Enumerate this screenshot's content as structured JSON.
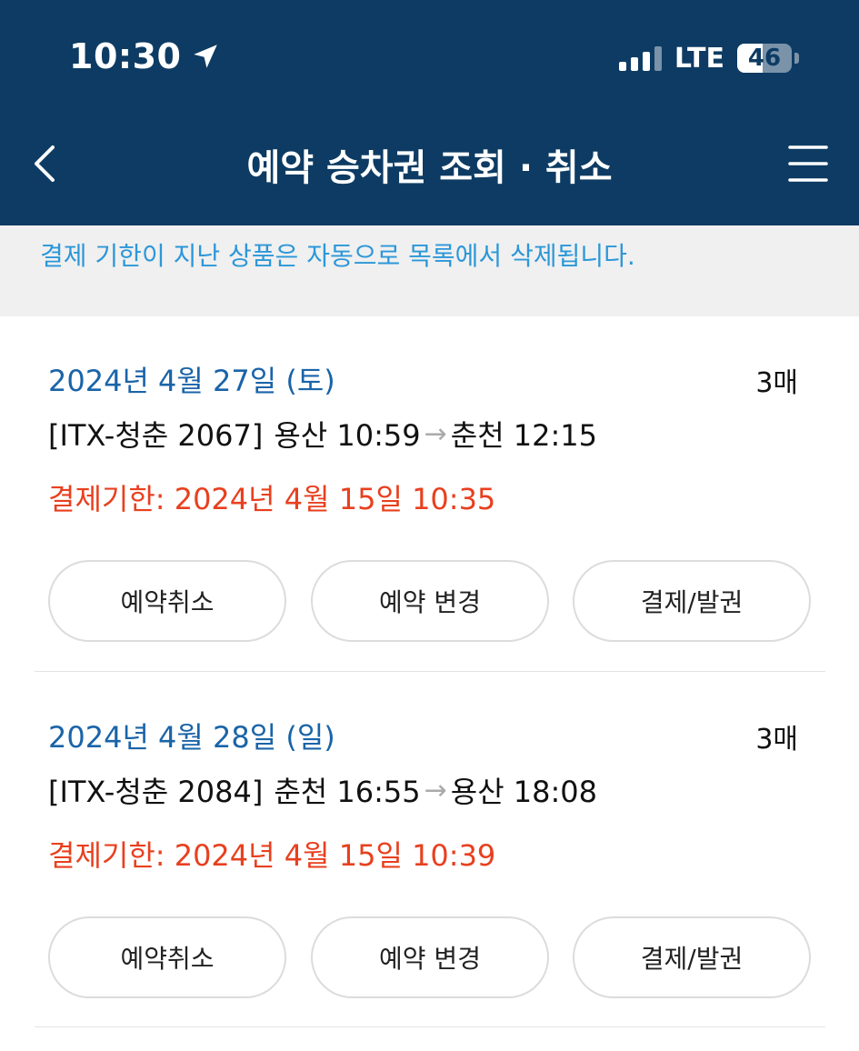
{
  "status_bar": {
    "time": "10:30",
    "network": "LTE",
    "battery": "46",
    "battery_level": 46
  },
  "header": {
    "title": "예약 승차권 조회 · 취소"
  },
  "notice": "결제 기한이 지난 상품은 자동으로 목록에서 삭제됩니다.",
  "reservations": [
    {
      "date": "2024년 4월 27일 (토)",
      "quantity": "3매",
      "train": "[ITX-청춘 2067]",
      "from": "용산 10:59",
      "to": "춘천 12:15",
      "deadline": "결제기한: 2024년 4월 15일 10:35",
      "buttons": {
        "cancel": "예약취소",
        "change": "예약 변경",
        "pay": "결제/발권"
      }
    },
    {
      "date": "2024년 4월 28일 (일)",
      "quantity": "3매",
      "train": "[ITX-청춘 2084]",
      "from": "춘천 16:55",
      "to": "용산 18:08",
      "deadline": "결제기한: 2024년 4월 15일 10:39",
      "buttons": {
        "cancel": "예약취소",
        "change": "예약 변경",
        "pay": "결제/발권"
      }
    }
  ]
}
